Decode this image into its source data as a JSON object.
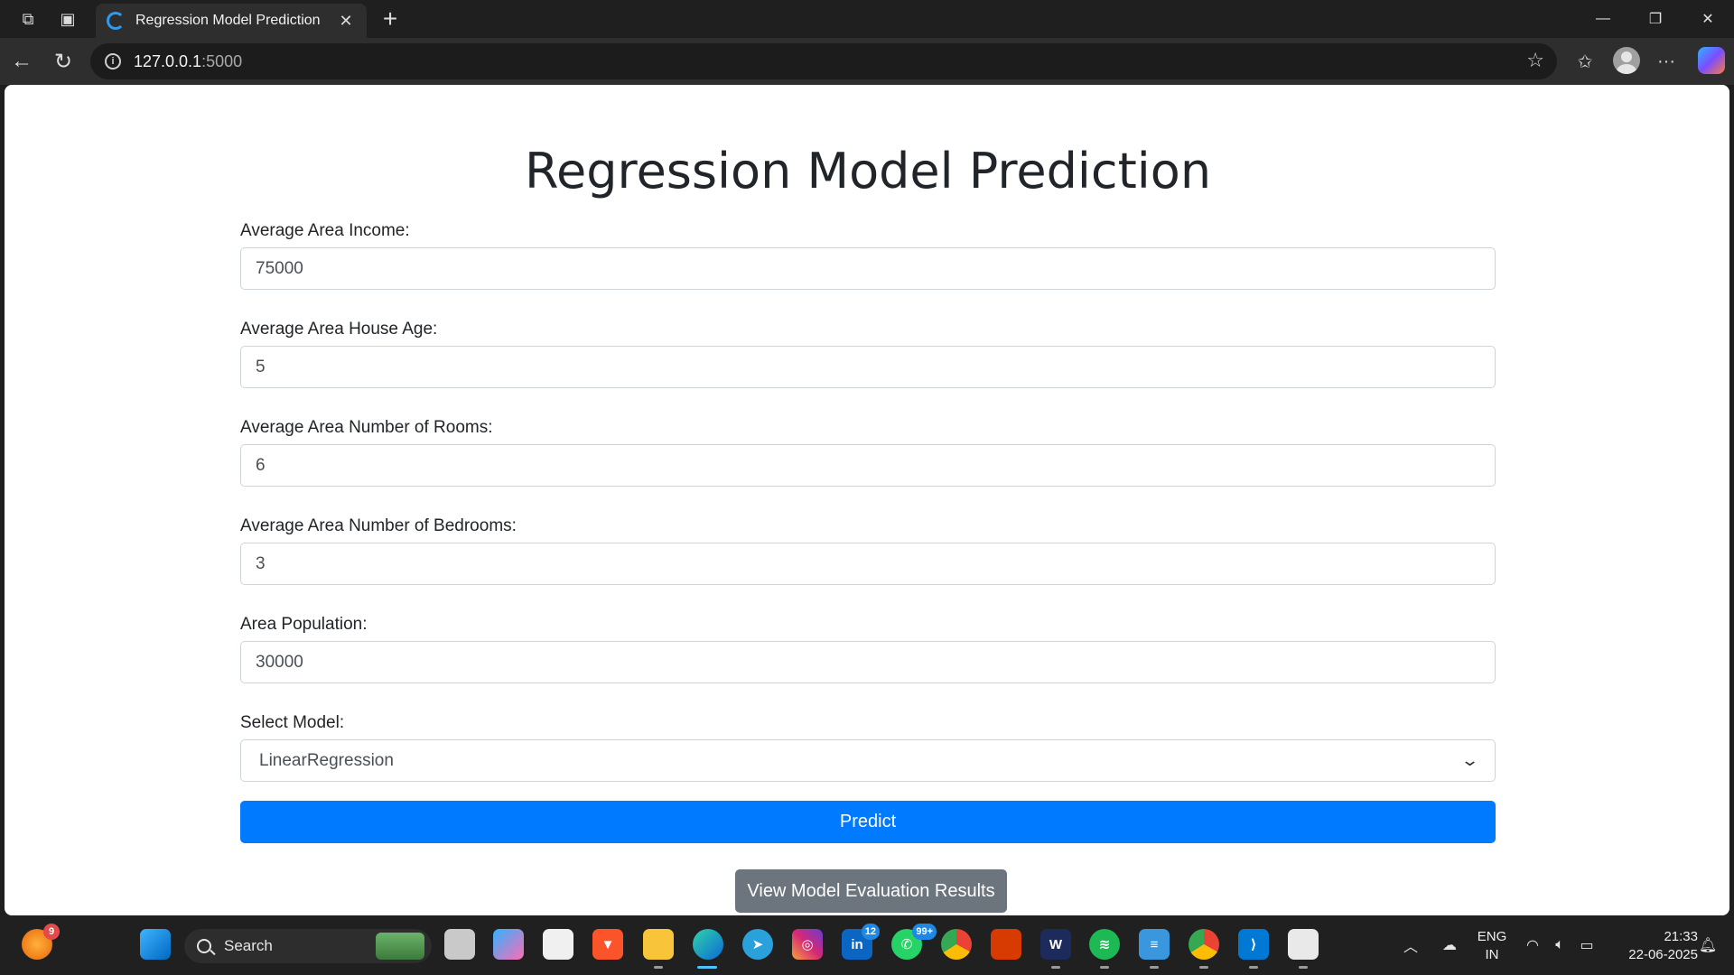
{
  "browser": {
    "tab_title": "Regression Model Prediction",
    "url_host": "127.0.0.1",
    "url_port": ":5000"
  },
  "page": {
    "title": "Regression Model Prediction",
    "fields": [
      {
        "label": "Average Area Income:",
        "value": "75000"
      },
      {
        "label": "Average Area House Age:",
        "value": "5"
      },
      {
        "label": "Average Area Number of Rooms:",
        "value": "6"
      },
      {
        "label": "Average Area Number of Bedrooms:",
        "value": "3"
      },
      {
        "label": "Area Population:",
        "value": "30000"
      }
    ],
    "model_label": "Select Model:",
    "model_selected": "LinearRegression",
    "predict_label": "Predict",
    "eval_label": "View Model Evaluation Results"
  },
  "taskbar": {
    "search_placeholder": "Search",
    "browser_badge": "9",
    "linkedin_badge": "12",
    "whatsapp_badge": "99+",
    "language": "ENG",
    "region": "IN",
    "time": "21:33",
    "date": "22-06-2025"
  },
  "colors": {
    "primary": "#007bff",
    "secondary": "#6c757d"
  }
}
